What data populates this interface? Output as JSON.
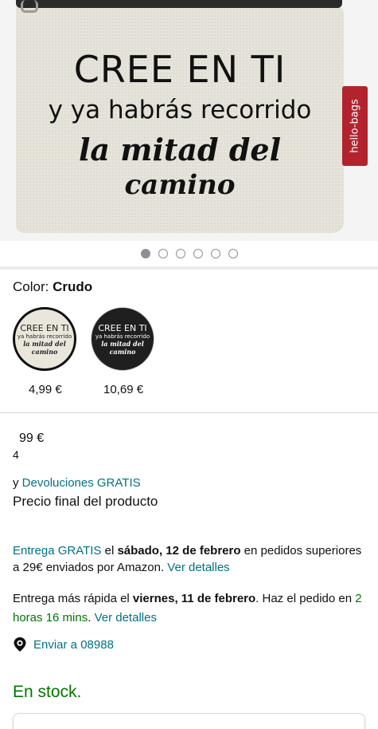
{
  "product_image": {
    "line1": "CREE EN TI",
    "line2": "y ya habrás recorrido",
    "line3": "la mitad del",
    "line4": "camino",
    "brand_tag": "hello-bags"
  },
  "carousel": {
    "total": 6,
    "active": 0
  },
  "color": {
    "label": "Color:",
    "value": "Crudo"
  },
  "swatches": [
    {
      "l1": "CREE EN TI",
      "l2": "ya habrás recorrido",
      "l3": "la mitad del",
      "l4": "camino",
      "price": "4,99 €",
      "selected": true
    },
    {
      "l1": "CREE EN TI",
      "l2": "ya habrás recorrido",
      "l3": "la mitad del",
      "l4": "camino",
      "price": "10,69 €",
      "selected": false
    }
  ],
  "price": {
    "decimal_part": "99 €",
    "integer_part": "4"
  },
  "returns": {
    "prefix": "y ",
    "link": "Devoluciones GRATIS"
  },
  "final_price_text": "Precio final del producto",
  "delivery": {
    "link": "Entrega GRATIS",
    "t1": " el ",
    "date": "sábado, 12 de febrero",
    "t2": " en pedidos superiores a 29€ enviados por Amazon. ",
    "details": "Ver detalles"
  },
  "fast_delivery": {
    "t1": "Entrega más rápida el ",
    "date": "viernes, 11 de febrero",
    "t2": ". Haz el pedido en ",
    "time": "2 horas 16 mins",
    "t3": ". ",
    "details": "Ver detalles"
  },
  "location": {
    "label": "Enviar a  08988",
    "icon": "location-pin-icon"
  },
  "stock": "En stock.",
  "colors": {
    "link": "#007185",
    "green": "#007600",
    "brand_tag": "#b2232e"
  }
}
